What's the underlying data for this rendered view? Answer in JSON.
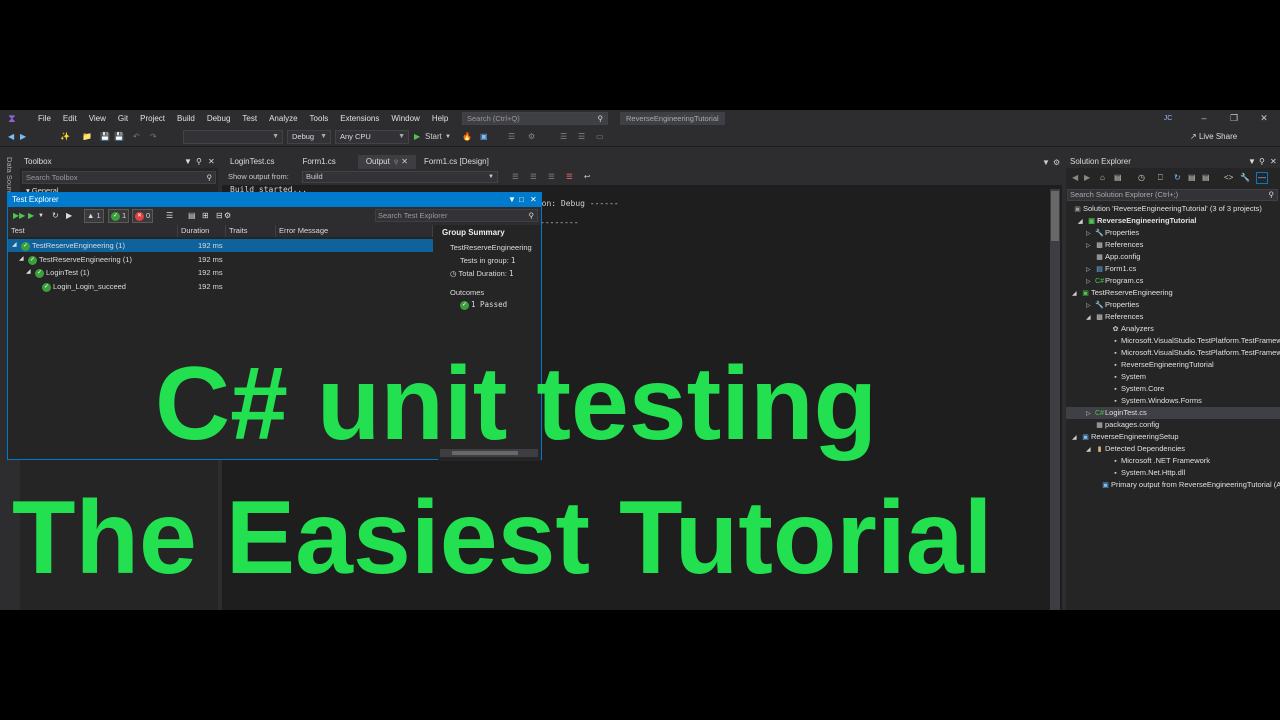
{
  "menubar": {
    "items": [
      "File",
      "Edit",
      "View",
      "Git",
      "Project",
      "Build",
      "Debug",
      "Test",
      "Analyze",
      "Tools",
      "Extensions",
      "Window",
      "Help"
    ],
    "search_placeholder": "Search (Ctrl+Q)",
    "solution_name": "ReverseEngineeringTutorial",
    "user_initials": "JC"
  },
  "toolbar": {
    "config": "Debug",
    "platform": "Any CPU",
    "start_label": "Start",
    "live_share": "Live Share"
  },
  "side_strip": "Data Sources",
  "toolbox": {
    "title": "Toolbox",
    "search_placeholder": "Search Toolbox",
    "first_group": "General"
  },
  "doc_tabs": [
    "LoginTest.cs",
    "Form1.cs",
    "Output",
    "Form1.cs [Design]"
  ],
  "output": {
    "show_from_label": "Show output from:",
    "source": "Build",
    "lines": [
      "Build started...",
      "tion: Debug ------",
      "--------"
    ]
  },
  "test_explorer": {
    "title": "Test Explorer",
    "counts": {
      "total": "1",
      "passed": "1",
      "failed": "0"
    },
    "search_placeholder": "Search Test Explorer",
    "columns": [
      "Test",
      "Duration",
      "Traits",
      "Error Message"
    ],
    "rows": [
      {
        "name": "TestReserveEngineering  (1)",
        "duration": "192 ms"
      },
      {
        "name": "TestReserveEngineering  (1)",
        "duration": "192 ms"
      },
      {
        "name": "LoginTest  (1)",
        "duration": "192 ms"
      },
      {
        "name": "Login_Login_succeed",
        "duration": "192 ms"
      }
    ],
    "group_summary": {
      "title": "Group Summary",
      "group_name": "TestReserveEngineering",
      "tests_in_group_label": "Tests in group:",
      "tests_in_group": "1",
      "total_duration_label": "Total Duration:",
      "total_duration": "1",
      "outcomes_label": "Outcomes",
      "passed": "1 Passed"
    }
  },
  "solution_explorer": {
    "title": "Solution Explorer",
    "search_placeholder": "Search Solution Explorer (Ctrl+;)",
    "items": [
      "Solution 'ReverseEngineeringTutorial' (3 of 3 projects)",
      "ReverseEngineeringTutorial",
      "Properties",
      "References",
      "App.config",
      "Form1.cs",
      "Program.cs",
      "TestReserveEngineering",
      "Properties",
      "References",
      "Analyzers",
      "Microsoft.VisualStudio.TestPlatform.TestFramework",
      "Microsoft.VisualStudio.TestPlatform.TestFramework.Extensions",
      "ReverseEngineeringTutorial",
      "System",
      "System.Core",
      "System.Windows.Forms",
      "LoginTest.cs",
      "packages.config",
      "ReverseEngineeringSetup",
      "Detected Dependencies",
      "Microsoft .NET Framework",
      "System.Net.Http.dll",
      "Primary output from ReverseEngineeringTutorial (Active)"
    ]
  },
  "overlay": {
    "line1": "C# unit testing",
    "line2": "The Easiest Tutorial",
    "color": "#22e04f"
  }
}
